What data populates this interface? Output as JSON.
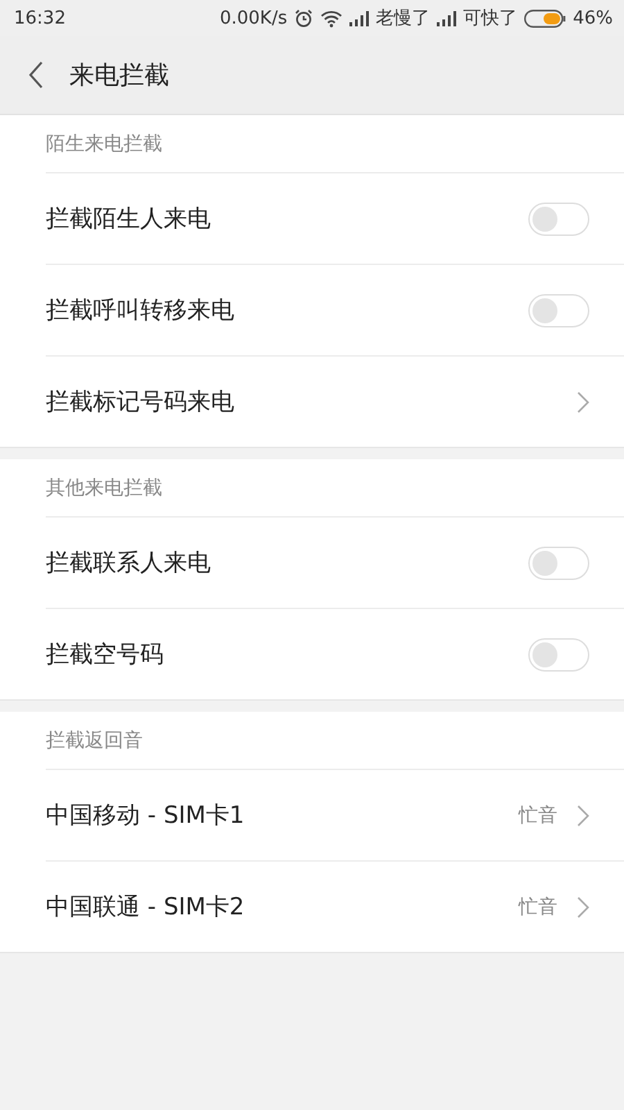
{
  "status_bar": {
    "time": "16:32",
    "speed": "0.00K/s",
    "carrier_1": "老慢了",
    "carrier_2": "可快了",
    "battery": "46%"
  },
  "header": {
    "title": "来电拦截"
  },
  "sections": [
    {
      "title": "陌生来电拦截",
      "rows": [
        {
          "kind": "toggle",
          "label": "拦截陌生人来电",
          "on": false
        },
        {
          "kind": "toggle",
          "label": "拦截呼叫转移来电",
          "on": false
        },
        {
          "kind": "link",
          "label": "拦截标记号码来电"
        }
      ]
    },
    {
      "title": "其他来电拦截",
      "rows": [
        {
          "kind": "toggle",
          "label": "拦截联系人来电",
          "on": false
        },
        {
          "kind": "toggle",
          "label": "拦截空号码",
          "on": false
        }
      ]
    },
    {
      "title": "拦截返回音",
      "rows": [
        {
          "kind": "link",
          "label": "中国移动 - SIM卡1",
          "value": "忙音"
        },
        {
          "kind": "link",
          "label": "中国联通 - SIM卡2",
          "value": "忙音"
        }
      ]
    }
  ]
}
